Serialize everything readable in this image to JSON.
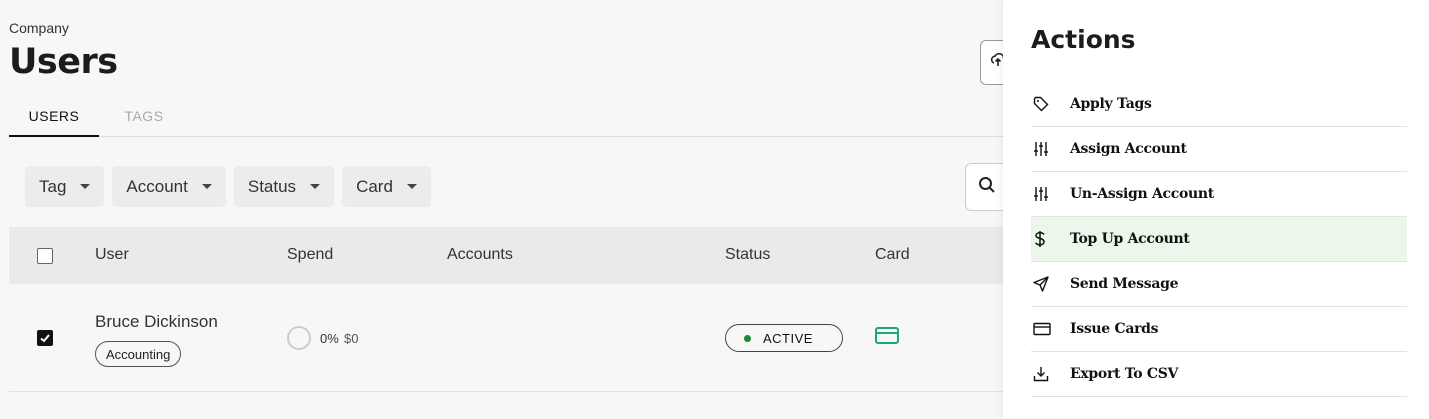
{
  "page": {
    "breadcrumb": "Company",
    "title": "Users"
  },
  "tabs": [
    {
      "label": "USERS",
      "active": true
    },
    {
      "label": "TAGS",
      "active": false
    }
  ],
  "filters": [
    {
      "label": "Tag"
    },
    {
      "label": "Account"
    },
    {
      "label": "Status"
    },
    {
      "label": "Card"
    }
  ],
  "table": {
    "columns": [
      "User",
      "Spend",
      "Accounts",
      "Status",
      "Card"
    ],
    "rows": [
      {
        "checked": true,
        "user": "Bruce Dickinson",
        "tag": "Accounting",
        "spend_pct": "0%",
        "spend_amount": "$0",
        "accounts": "",
        "status": "ACTIVE",
        "status_color": "#1a8a34",
        "card_icon": "credit-card-icon"
      }
    ]
  },
  "actions_panel": {
    "title": "Actions",
    "items": [
      {
        "label": "Apply Tags",
        "icon": "tag-icon"
      },
      {
        "label": "Assign Account",
        "icon": "sliders-icon"
      },
      {
        "label": "Un-Assign Account",
        "icon": "sliders-icon"
      },
      {
        "label": "Top Up Account",
        "icon": "dollar-icon",
        "highlighted": true
      },
      {
        "label": "Send Message",
        "icon": "send-icon"
      },
      {
        "label": "Issue Cards",
        "icon": "card-icon"
      },
      {
        "label": "Export To CSV",
        "icon": "download-icon"
      }
    ]
  },
  "colors": {
    "highlight": "#eaf7ea",
    "card_accent": "#1aa87a",
    "active_dot": "#1a8a34"
  }
}
